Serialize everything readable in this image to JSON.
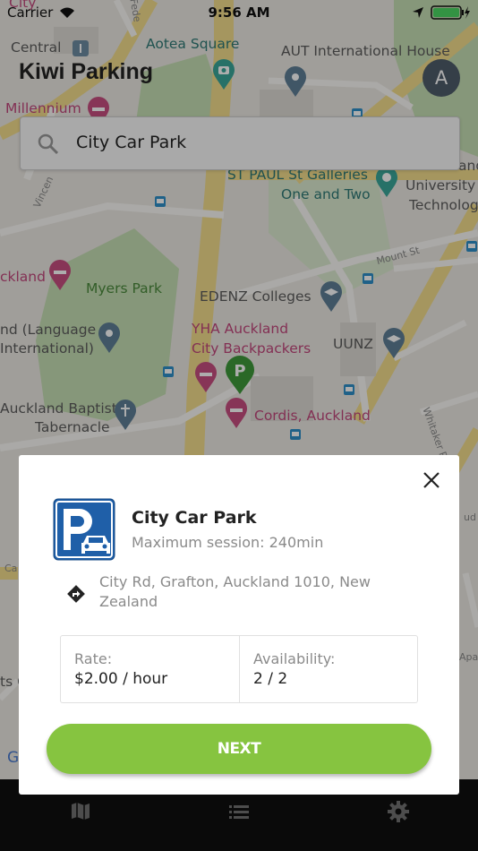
{
  "status_bar": {
    "carrier": "Carrier",
    "time": "9:56 AM"
  },
  "header": {
    "title": "Kiwi Parking",
    "avatar_initial": "A"
  },
  "search": {
    "value": "City Car Park",
    "icon": "search-icon"
  },
  "map": {
    "labels": {
      "city": "City",
      "central": "Central",
      "aotea": "Aotea Square",
      "aut": "AUT International House",
      "millennium": "Millennium",
      "stpaul": "ST PAUL St Galleries",
      "one_two": "One and Two",
      "university": "University",
      "technology": "Technolog",
      "and_top": "and",
      "auckland": "ckland",
      "myers": "Myers Park",
      "edenz": "EDENZ Colleges",
      "language": "nd (Language",
      "international": "International)",
      "yha1": "YHA Auckland",
      "yha2": "City Backpackers",
      "uunz": "UUNZ",
      "baptist": "Auckland Baptist",
      "tabernacle": "Tabernacle",
      "cordis": "Cordis, Auckland",
      "mount": "Mount St",
      "fede": "Fede",
      "vincent": "Vincen",
      "whitaker": "Whitaker Pl",
      "ca": "Ca",
      "ts": "ts C",
      "apa": "Apa",
      "und": "ud"
    },
    "colors": {
      "park": "#c6dfb4",
      "road": "#f4dd8c",
      "base": "#ece9e3"
    }
  },
  "popup": {
    "name": "City Car Park",
    "session": "Maximum session: 240min",
    "address": "City Rd, Grafton, Auckland 1010, New Zealand",
    "rate_label": "Rate:",
    "rate_value": "$2.00 / hour",
    "availability_label": "Availability:",
    "availability_value": "2 / 2",
    "next_label": "NEXT",
    "accent": "#86c440",
    "logo_color": "#1f5fa8"
  },
  "tabbar": {
    "items": [
      "map-icon",
      "list-icon",
      "gear-icon"
    ]
  }
}
